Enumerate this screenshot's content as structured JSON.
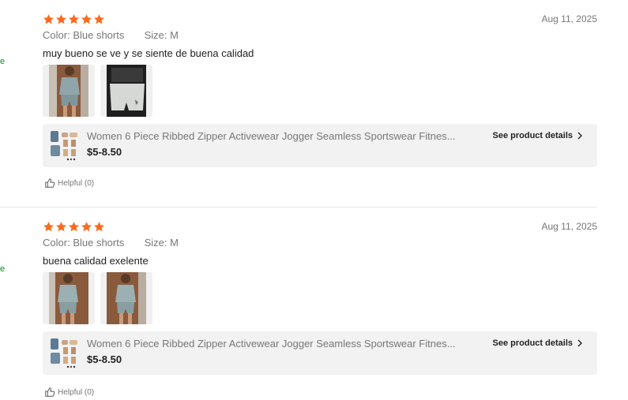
{
  "colors": {
    "star": "#fb6b1e",
    "link_fragment": "#0a8a2a",
    "muted_text": "#777777",
    "card_bg": "#f2f2f2"
  },
  "edge_fragments": [
    "e",
    "e"
  ],
  "reviews": [
    {
      "rating": 5,
      "date": "Aug 11, 2025",
      "color_label": "Color:",
      "color_value": "Blue shorts",
      "size_label": "Size:",
      "size_value": "M",
      "text": "muy bueno se ve y se siente de buena calidad",
      "photos": [
        "review-photo-1",
        "review-photo-2"
      ],
      "product": {
        "name": "Women 6 Piece Ribbed Zipper Activewear Jogger Seamless Sportswear Fitnes...",
        "price": "$5-8.50",
        "details_label": "See product details"
      },
      "helpful_label": "Helpful (0)",
      "icons": {
        "star": "star-icon",
        "chevron": "chevron-right-icon",
        "thumb": "thumb-up-icon"
      }
    },
    {
      "rating": 5,
      "date": "Aug 11, 2025",
      "color_label": "Color:",
      "color_value": "Blue shorts",
      "size_label": "Size:",
      "size_value": "M",
      "text": "buena calidad exelente",
      "photos": [
        "review-photo-1",
        "review-photo-2"
      ],
      "product": {
        "name": "Women 6 Piece Ribbed Zipper Activewear Jogger Seamless Sportswear Fitnes...",
        "price": "$5-8.50",
        "details_label": "See product details"
      },
      "helpful_label": "Helpful (0)",
      "icons": {
        "star": "star-icon",
        "chevron": "chevron-right-icon",
        "thumb": "thumb-up-icon"
      }
    }
  ]
}
